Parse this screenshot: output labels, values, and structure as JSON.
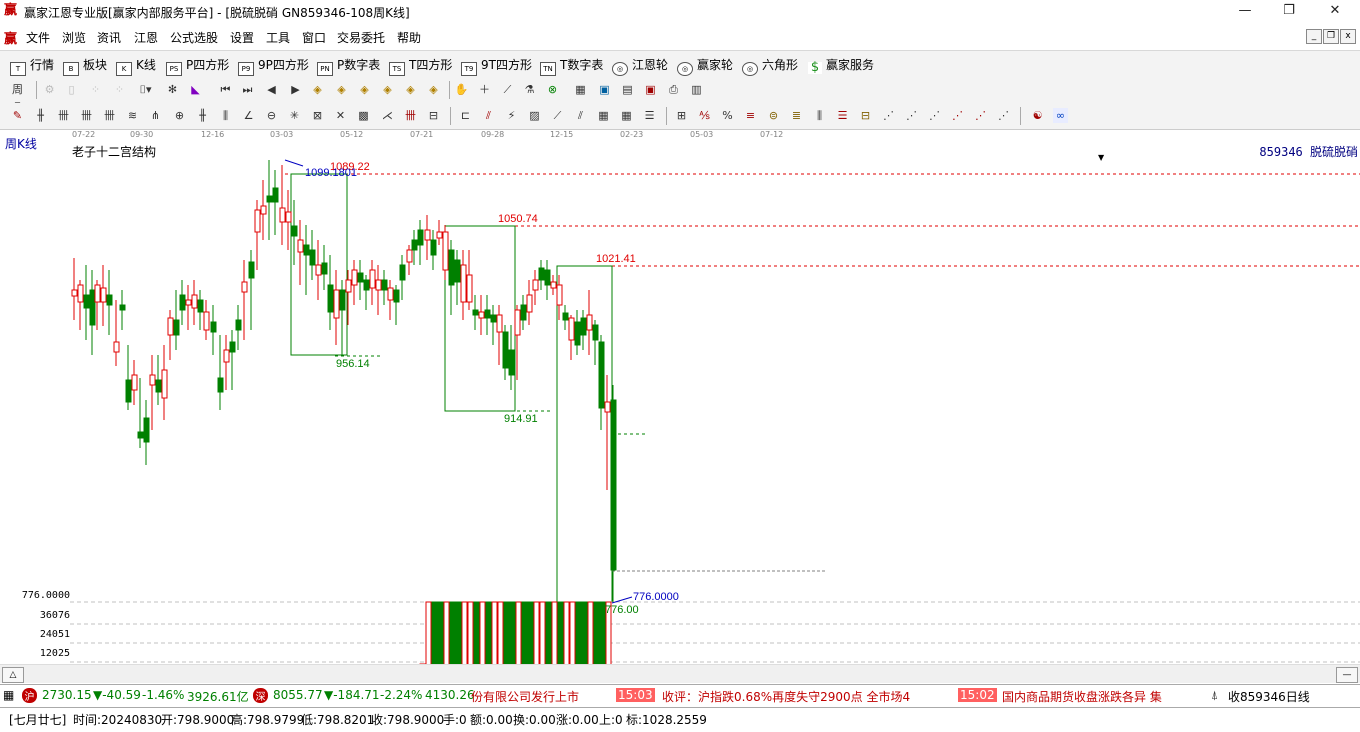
{
  "titlebar": {
    "title": "赢家江恩专业版[赢家内部服务平台] - [脱硫脱硝  GN859346-108周K线]",
    "logo": "赢",
    "min_icon": "minimize-icon",
    "max_icon": "restore-icon",
    "close_icon": "close-icon"
  },
  "menu": {
    "logo": "赢",
    "items": [
      "文件",
      "浏览",
      "资讯",
      "江恩",
      "公式选股",
      "设置",
      "工具",
      "窗口",
      "交易委托",
      "帮助"
    ]
  },
  "toolbar1": {
    "items": [
      {
        "label": "行情",
        "icon": "T"
      },
      {
        "label": "板块",
        "icon": "B"
      },
      {
        "label": "K线",
        "icon": "K"
      },
      {
        "label": "P四方形",
        "icon": "PS"
      },
      {
        "label": "9P四方形",
        "icon": "P9"
      },
      {
        "label": "P数字表",
        "icon": "PN"
      },
      {
        "label": "T四方形",
        "icon": "TS"
      },
      {
        "label": "9T四方形",
        "icon": "T9"
      },
      {
        "label": "T数字表",
        "icon": "TN"
      },
      {
        "label": "江恩轮",
        "icon": "◎"
      },
      {
        "label": "赢家轮",
        "icon": "◎"
      },
      {
        "label": "六角形",
        "icon": "◎"
      },
      {
        "label": "赢家服务",
        "icon": "$"
      }
    ]
  },
  "chart": {
    "period_label": "周K线",
    "formula_name": "老子十二宫结构",
    "stock_label": "859346 脱硫脱硝",
    "time_labels": [
      "07-22",
      "09-30",
      "12-16",
      "03-03",
      "05-12",
      "07-21",
      "09-28",
      "12-15",
      "02-23",
      "05-03",
      "07-12"
    ],
    "annotations": {
      "h1": "1089.22",
      "h1b": "1099.1801",
      "h2": "1050.74",
      "h3": "1021.41",
      "l1": "956.14",
      "l2": "914.91",
      "l3": "776.00",
      "l3b": "776.0000"
    },
    "volume_scale": [
      "776.0000",
      "36076",
      "24051",
      "12025"
    ],
    "colors": {
      "up": "#e00000",
      "down": "#008000",
      "box": "#008000",
      "hline": "#e00000"
    }
  },
  "ticker": {
    "sh": {
      "value": "2730.15",
      "change": "▼-40.59",
      "pct": "-1.46%",
      "amount": "3926.61亿"
    },
    "sz": {
      "value": "8055.77",
      "change": "▼-184.71",
      "pct": "-2.24%",
      "amount": "4130.26"
    },
    "news1": "份有限公司发行上市",
    "time1": "15:03",
    "news2": "收评：沪指跌0.68%再度失守2900点 全市场4",
    "time2": "15:02",
    "news3": "国内商品期货收盘涨跌各异 集",
    "right": "收859346日线"
  },
  "status": {
    "lunar": "[七月廿七]",
    "time": "时间:20240830",
    "open": "开:798.9000",
    "high": "高:798.9799",
    "low": "低:798.8201",
    "close": "收:798.9000",
    "hand": "手:0",
    "amount": "额:0.00",
    "turnover": "换:0.00",
    "rise": "涨:0.00",
    "up": "上:0",
    "mark": "标:1028.2559"
  }
}
